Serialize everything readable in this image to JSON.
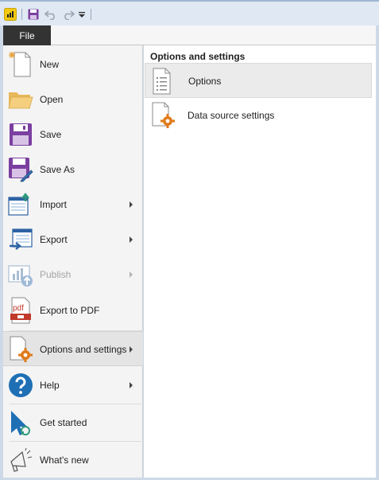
{
  "quick_access": {
    "app_icon": "power-bi-logo-icon",
    "save_icon": "save-icon",
    "undo_icon": "undo-icon",
    "redo_icon": "redo-icon",
    "customize_icon": "customize-dropdown-icon"
  },
  "ribbon": {
    "file_tab": "File"
  },
  "file_menu": {
    "items": [
      {
        "label": "New",
        "icon": "new-document-icon",
        "submenu": false
      },
      {
        "label": "Open",
        "icon": "folder-icon",
        "submenu": false
      },
      {
        "label": "Save",
        "icon": "save-icon",
        "submenu": false
      },
      {
        "label": "Save As",
        "icon": "save-as-icon",
        "submenu": false
      },
      {
        "label": "Import",
        "icon": "import-icon",
        "submenu": true
      },
      {
        "label": "Export",
        "icon": "export-icon",
        "submenu": true
      },
      {
        "label": "Publish",
        "icon": "publish-icon",
        "submenu": true,
        "disabled": true
      },
      {
        "label": "Export to PDF",
        "icon": "pdf-icon",
        "submenu": false
      },
      {
        "label": "Options and settings",
        "icon": "options-gear-icon",
        "submenu": true,
        "selected": true
      },
      {
        "label": "Help",
        "icon": "help-icon",
        "submenu": true
      },
      {
        "label": "Get started",
        "icon": "get-started-icon",
        "submenu": false
      },
      {
        "label": "What's new",
        "icon": "megaphone-icon",
        "submenu": false
      }
    ]
  },
  "options_panel": {
    "title": "Options and settings",
    "items": [
      {
        "label": "Options",
        "icon": "options-document-icon"
      },
      {
        "label": "Data source settings",
        "icon": "data-source-gear-icon"
      }
    ]
  },
  "colors": {
    "file_tab": "#333333",
    "accent_purple": "#7b3fa0",
    "accent_orange": "#e07b1a",
    "help_blue": "#1f6fb5"
  }
}
